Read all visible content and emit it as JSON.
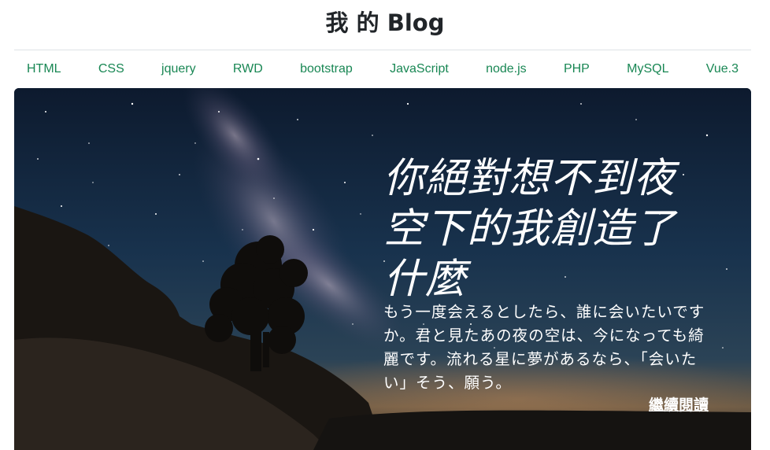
{
  "header": {
    "title": "我 的 Blog"
  },
  "nav": {
    "items": [
      {
        "label": "HTML"
      },
      {
        "label": "CSS"
      },
      {
        "label": "jquery"
      },
      {
        "label": "RWD"
      },
      {
        "label": "bootstrap"
      },
      {
        "label": "JavaScript"
      },
      {
        "label": "node.js"
      },
      {
        "label": "PHP"
      },
      {
        "label": "MySQL"
      },
      {
        "label": "Vue.3"
      }
    ]
  },
  "hero": {
    "title": "你絕對想不到夜空下的我創造了什麼",
    "text": "もう一度会えるとしたら、誰に会いたいですか。君と見たあの夜の空は、今になっても綺麗です。流れる星に夢があるなら、「会いたい」そう、願う。",
    "link_label": "繼續閱讀"
  },
  "colors": {
    "nav_link": "#198754",
    "title": "#212529",
    "divider": "#dee2e6"
  },
  "icons": {
    "hero_image": "starry-night-milky-way-image"
  }
}
